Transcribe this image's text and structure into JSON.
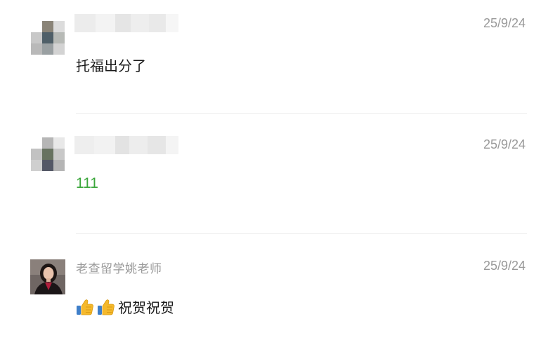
{
  "comments": [
    {
      "author": "",
      "date": "25/9/24",
      "text": "托福出分了",
      "avatar_colors": [
        "#ffffff",
        "#8a8478",
        "#dcdcdc",
        "#c8c8c8",
        "#4f5f68",
        "#b7bab6",
        "#b9b9b9",
        "#9aa0a2",
        "#d3d3d3"
      ],
      "name_blur_colors": [
        "#ececec",
        "#f3f3f3",
        "#e5e5e5",
        "#eeeeee",
        "#e9e9e9",
        "#f1f1f1"
      ]
    },
    {
      "author": "",
      "date": "25/9/24",
      "text": "111",
      "avatar_colors": [
        "#ffffff",
        "#b6b6b6",
        "#e8e8e8",
        "#c2c2c2",
        "#677260",
        "#c8c8c8",
        "#cfcfcf",
        "#545866",
        "#b5b5b5"
      ],
      "name_blur_colors": [
        "#eeeeee",
        "#f2f2f2",
        "#e3e3e3",
        "#ededed",
        "#e6e6e6",
        "#f0f0f0"
      ]
    },
    {
      "author": "老查留学姚老师",
      "date": "25/9/24",
      "text": "祝贺祝贺",
      "emoji": [
        "thumbs-up",
        "thumbs-up"
      ]
    }
  ],
  "colors": {
    "link_text": "#3aa63a",
    "meta_text": "#999999",
    "divider": "#ededed"
  }
}
